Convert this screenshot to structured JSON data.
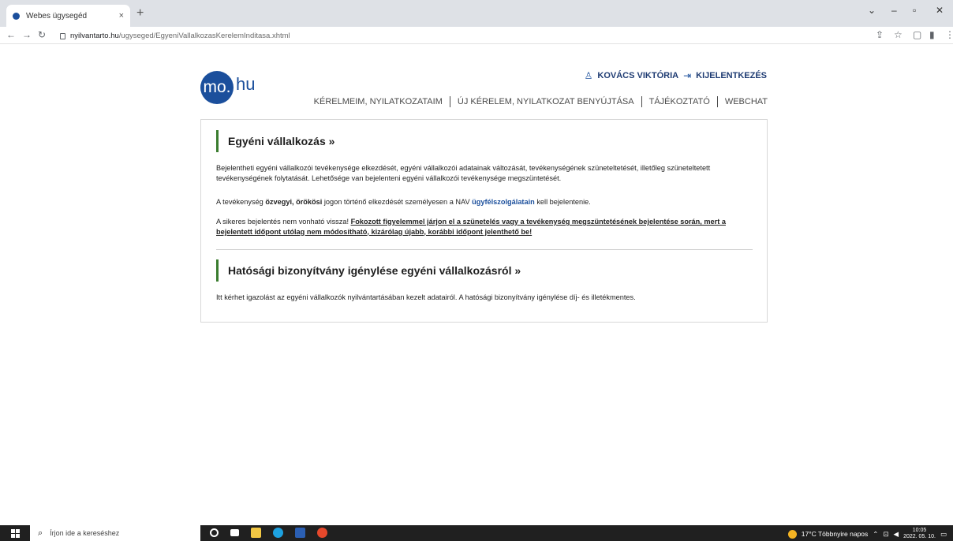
{
  "browser": {
    "tab_title": "Webes ügysegéd",
    "tab_close": "×",
    "new_tab": "+",
    "url_host": "nyilvantarto.hu",
    "url_path": "/ugyseged/EgyeniVallalkozasKerelemInditasa.xhtml"
  },
  "header": {
    "logo_circle": "mo.",
    "logo_rest": "hu",
    "user_name": "KOVÁCS VIKTÓRIA",
    "logout": "KIJELENTKEZÉS",
    "nav": [
      "KÉRELMEIM, NYILATKOZATAIM",
      "ÚJ KÉRELEM, NYILATKOZAT BENYÚJTÁSA",
      "TÁJÉKOZTATÓ",
      "WEBCHAT"
    ]
  },
  "section1": {
    "title": "Egyéni vállalkozás  »",
    "p1": "Bejelentheti egyéni vállalkozói tevékenysége elkezdését, egyéni vállalkozói adatainak változását, tevékenységének szüneteltetését, illetőleg szüneteltetett tevékenységének folytatását. Lehetősége van bejelenteni egyéni vállalkozói tevékenysége megszüntetését.",
    "p2_a": "A tevékenység ",
    "p2_b": "özvegyi, örökösi",
    "p2_c": " jogon történő elkezdését személyesen a NAV ",
    "p2_link": "ügyfélszolgálatain",
    "p2_d": " kell bejelentenie.",
    "p3_a": "A sikeres bejelentés nem vonható vissza! ",
    "p3_b": "Fokozott figyelemmel járjon el a szünetelés vagy a tevékenység megszüntetésének bejelentése során, mert a bejelentett időpont utólag nem módosítható, kizárólag újabb, korábbi időpont jelenthető be!"
  },
  "section2": {
    "title": "Hatósági bizonyítvány igénylése egyéni vállalkozásról  »",
    "p1": "Itt kérhet igazolást az egyéni vállalkozók nyilvántartásában kezelt adatairól. A hatósági bizonyítvány igénylése díj- és illetékmentes."
  },
  "taskbar": {
    "search_placeholder": "Írjon ide a kereséshez",
    "weather": "17°C  Többnyire napos",
    "time": "10:05",
    "date": "2022. 05. 10."
  }
}
